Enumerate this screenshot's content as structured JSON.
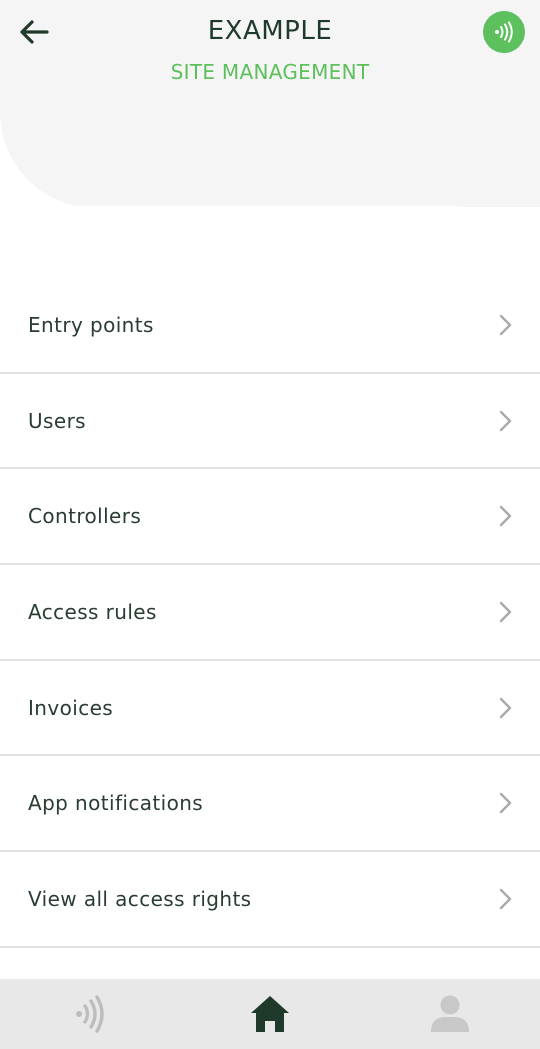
{
  "header": {
    "title": "EXAMPLE",
    "subtitle": "SITE MANAGEMENT",
    "back_icon": "arrow-left-icon",
    "nfc_icon": "nfc-signal-icon"
  },
  "colors": {
    "accent": "#5cc05c",
    "dark": "#1f3a2a",
    "header_bg": "#f5f5f5",
    "nav_bg": "#e8e8e8",
    "divider": "#e2e2e2"
  },
  "menu": {
    "items": [
      {
        "label": "Entry points"
      },
      {
        "label": "Users"
      },
      {
        "label": "Controllers"
      },
      {
        "label": "Access rules"
      },
      {
        "label": "Invoices"
      },
      {
        "label": "App notifications"
      },
      {
        "label": "View all access rights"
      }
    ]
  },
  "bottom_nav": {
    "items": [
      {
        "icon": "nfc-signal-icon",
        "active": false
      },
      {
        "icon": "home-icon",
        "active": true
      },
      {
        "icon": "profile-icon",
        "active": false
      }
    ]
  }
}
